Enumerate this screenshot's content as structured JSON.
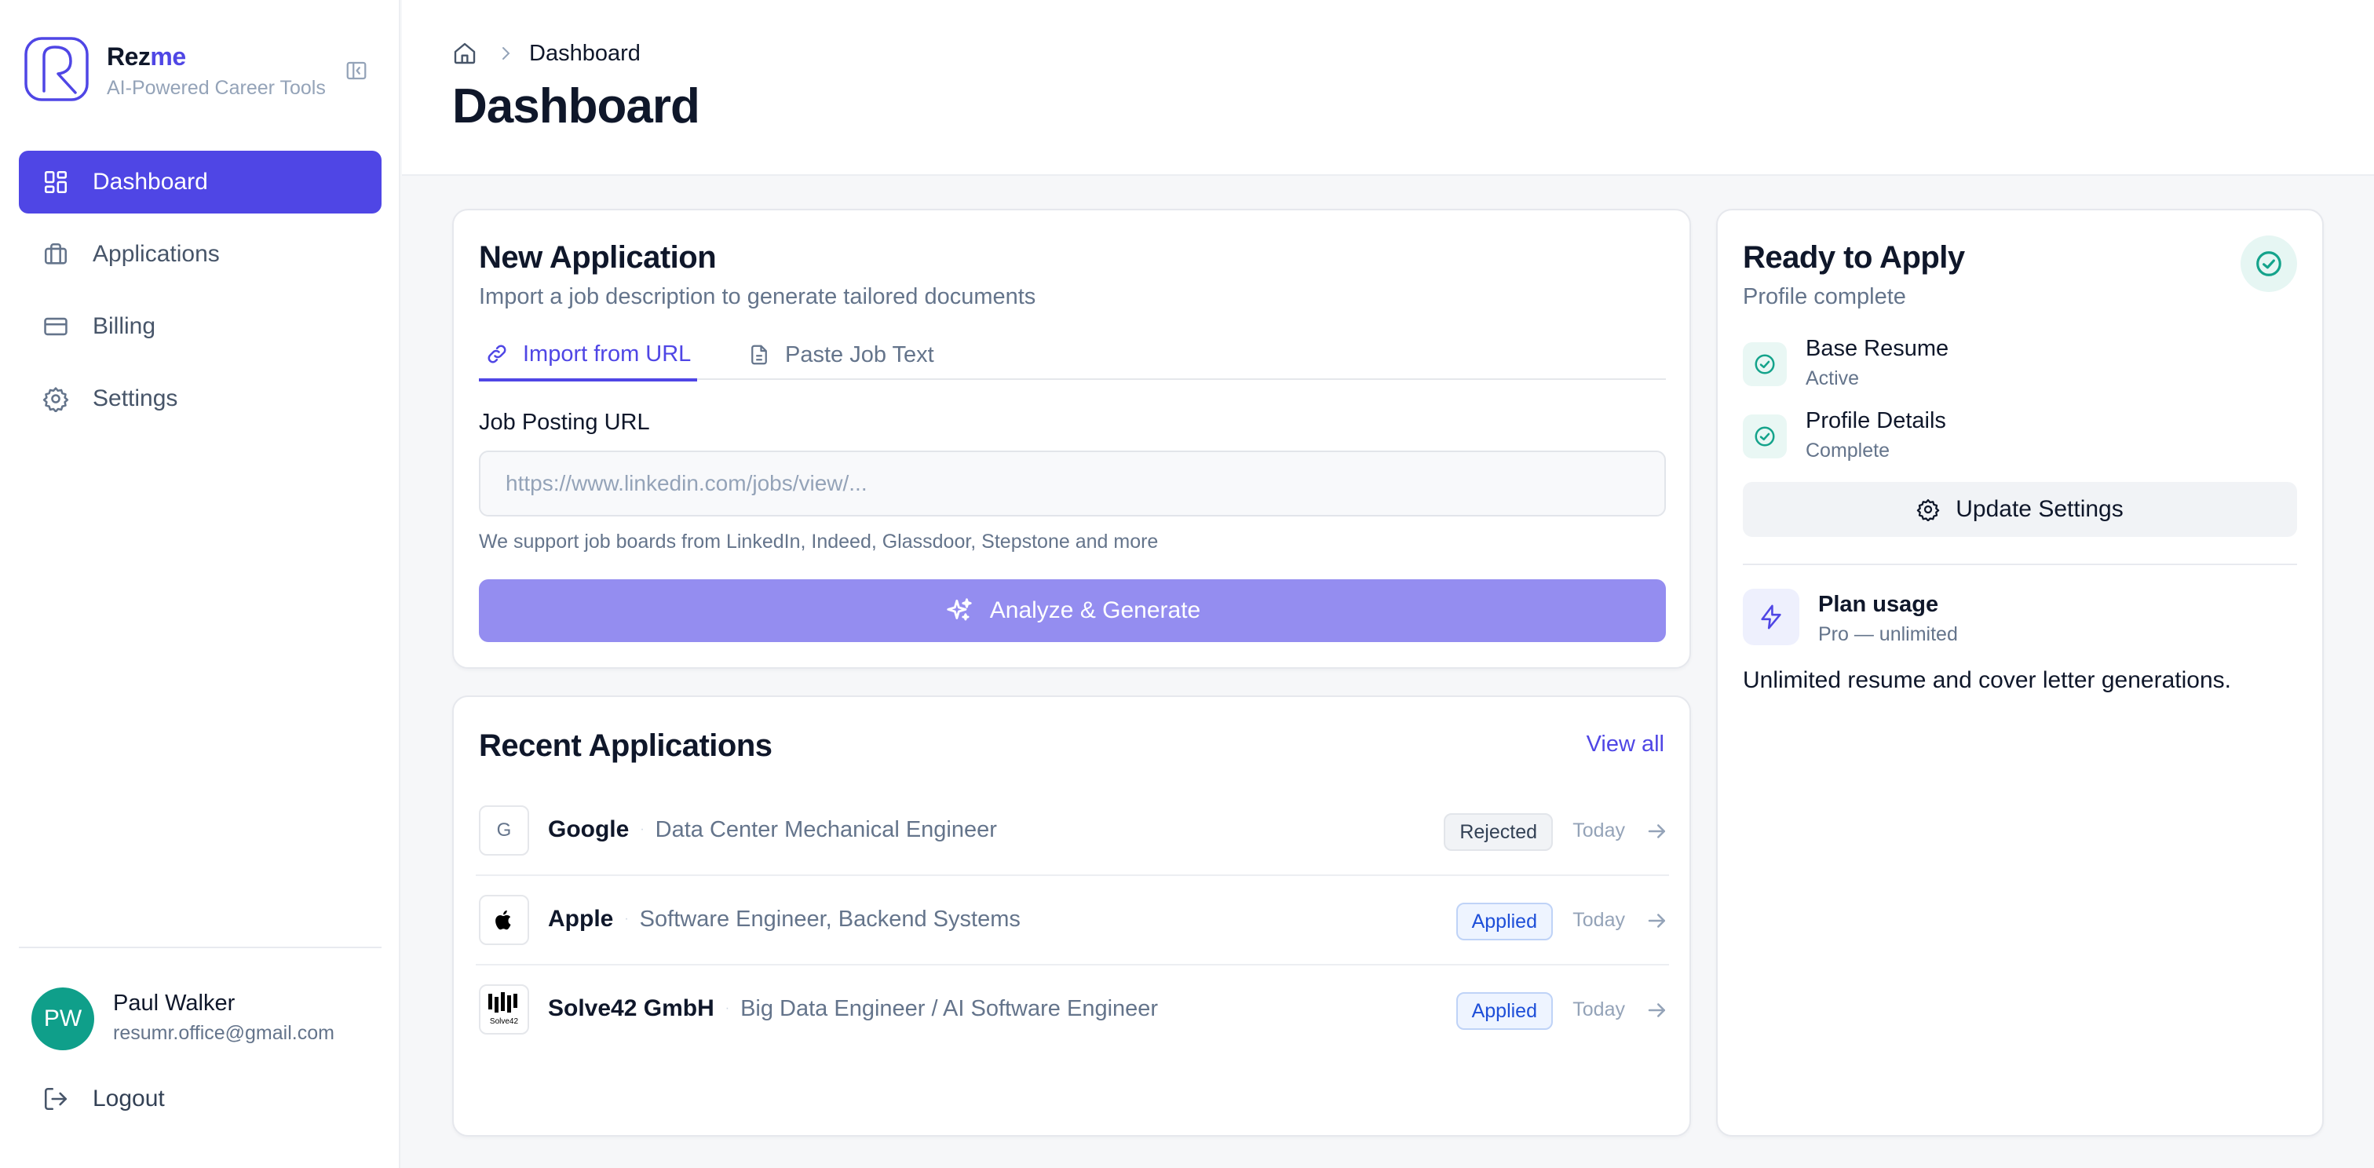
{
  "brand": {
    "name_main": "Rez",
    "name_accent": "me",
    "tagline": "AI-Powered Career Tools",
    "accent_color": "#4f46e5",
    "logo_icon": "rezme-logo-icon",
    "collapse_icon": "sidebar-collapse-icon"
  },
  "sidebar": {
    "items": [
      {
        "label": "Dashboard",
        "icon": "dashboard-grid-icon",
        "active": true
      },
      {
        "label": "Applications",
        "icon": "briefcase-icon",
        "active": false
      },
      {
        "label": "Billing",
        "icon": "credit-card-icon",
        "active": false
      },
      {
        "label": "Settings",
        "icon": "gear-icon",
        "active": false
      }
    ],
    "user": {
      "initials": "PW",
      "name": "Paul Walker",
      "email": "resumr.office@gmail.com",
      "avatar_color": "#0f9f8a"
    },
    "logout_label": "Logout"
  },
  "header": {
    "breadcrumb": "Dashboard",
    "title": "Dashboard"
  },
  "new_application": {
    "title": "New Application",
    "subtitle": "Import a job description to generate tailored documents",
    "tabs": [
      {
        "label": "Import from URL",
        "icon": "link-icon",
        "active": true
      },
      {
        "label": "Paste Job Text",
        "icon": "document-icon",
        "active": false
      }
    ],
    "field_label": "Job Posting URL",
    "placeholder": "https://www.linkedin.com/jobs/view/...",
    "value": "",
    "help": "We support job boards from LinkedIn, Indeed, Glassdoor, Stepstone and more",
    "button_label": "Analyze & Generate",
    "button_color": "#948df0"
  },
  "recent": {
    "title": "Recent Applications",
    "view_all": "View all",
    "rows": [
      {
        "logo": "G",
        "company": "Google",
        "role": "Data Center Mechanical Engineer",
        "status": "Rejected",
        "date": "Today"
      },
      {
        "logo": "apple-logo-icon",
        "company": "Apple",
        "role": "Software Engineer, Backend Systems",
        "status": "Applied",
        "date": "Today"
      },
      {
        "logo": "solve42-logo-icon",
        "company": "Solve42 GmbH",
        "role": "Big Data Engineer / AI Software Engineer",
        "status": "Applied",
        "date": "Today"
      }
    ],
    "solve42_logo_text": "Solve42"
  },
  "ready": {
    "title": "Ready to Apply",
    "subtitle": "Profile complete",
    "items": [
      {
        "name": "Base Resume",
        "value": "Active"
      },
      {
        "name": "Profile Details",
        "value": "Complete"
      }
    ],
    "update_label": "Update Settings",
    "plan_title": "Plan usage",
    "plan_sub": "Pro — unlimited",
    "plan_desc": "Unlimited resume and cover letter generations.",
    "success_color": "#14a38b"
  }
}
